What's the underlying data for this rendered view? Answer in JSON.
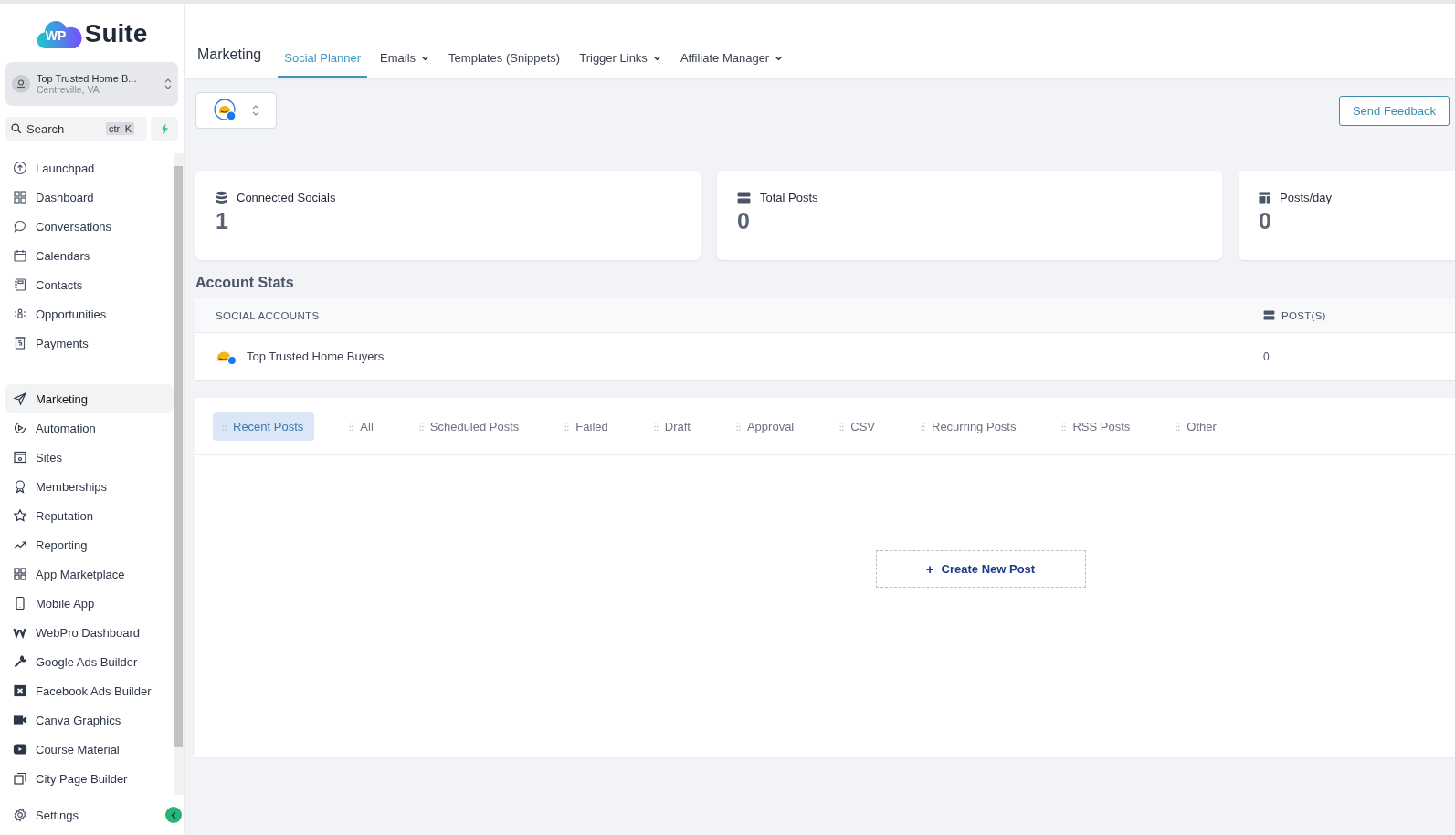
{
  "sidebar": {
    "brand": {
      "badge": "WP",
      "name": "Suite"
    },
    "account": {
      "name": "Top Trusted Home B...",
      "location": "Centreville, VA"
    },
    "search": {
      "placeholder": "Search",
      "shortcut": "ctrl K"
    },
    "primary_items": [
      {
        "label": "Launchpad",
        "selected": false
      },
      {
        "label": "Dashboard",
        "selected": false
      },
      {
        "label": "Conversations",
        "selected": false
      },
      {
        "label": "Calendars",
        "selected": false
      },
      {
        "label": "Contacts",
        "selected": false
      },
      {
        "label": "Opportunities",
        "selected": false
      },
      {
        "label": "Payments",
        "selected": false
      }
    ],
    "secondary_items": [
      {
        "label": "Marketing",
        "selected": true
      },
      {
        "label": "Automation",
        "selected": false
      },
      {
        "label": "Sites",
        "selected": false
      },
      {
        "label": "Memberships",
        "selected": false
      },
      {
        "label": "Reputation",
        "selected": false
      },
      {
        "label": "Reporting",
        "selected": false
      },
      {
        "label": "App Marketplace",
        "selected": false
      },
      {
        "label": "Mobile App",
        "selected": false
      },
      {
        "label": "WebPro Dashboard",
        "selected": false
      },
      {
        "label": "Google Ads Builder",
        "selected": false
      },
      {
        "label": "Facebook Ads Builder",
        "selected": false
      },
      {
        "label": "Canva Graphics",
        "selected": false
      },
      {
        "label": "Course Material",
        "selected": false
      },
      {
        "label": "City Page Builder",
        "selected": false
      }
    ],
    "settings": "Settings"
  },
  "header": {
    "title": "Marketing",
    "tabs": [
      {
        "label": "Social Planner",
        "selected": true,
        "has_menu": false
      },
      {
        "label": "Emails",
        "selected": false,
        "has_menu": true
      },
      {
        "label": "Templates (Snippets)",
        "selected": false,
        "has_menu": false
      },
      {
        "label": "Trigger Links",
        "selected": false,
        "has_menu": true
      },
      {
        "label": "Affiliate Manager",
        "selected": false,
        "has_menu": true
      }
    ]
  },
  "toolbar": {
    "feedback_button": "Send Feedback"
  },
  "stat_cards": [
    {
      "kind": "database",
      "label": "Connected Socials",
      "value": "1"
    },
    {
      "kind": "server",
      "label": "Total Posts",
      "value": "0"
    },
    {
      "kind": "layout",
      "label": "Posts/day",
      "value": "0"
    }
  ],
  "account_stats": {
    "title": "Account Stats",
    "columns": [
      "SOCIAL ACCOUNTS",
      "POST(S)"
    ],
    "rows": [
      {
        "account": "Top Trusted Home Buyers",
        "posts": "0"
      }
    ]
  },
  "posts": {
    "tabs": [
      {
        "label": "Recent Posts",
        "selected": true
      },
      {
        "label": "All",
        "selected": false
      },
      {
        "label": "Scheduled Posts",
        "selected": false
      },
      {
        "label": "Failed",
        "selected": false
      },
      {
        "label": "Draft",
        "selected": false
      },
      {
        "label": "Approval",
        "selected": false
      },
      {
        "label": "CSV",
        "selected": false
      },
      {
        "label": "Recurring Posts",
        "selected": false
      },
      {
        "label": "RSS Posts",
        "selected": false
      },
      {
        "label": "Other",
        "selected": false
      }
    ],
    "create_button": {
      "icon": "+",
      "label": "Create New Post"
    }
  }
}
